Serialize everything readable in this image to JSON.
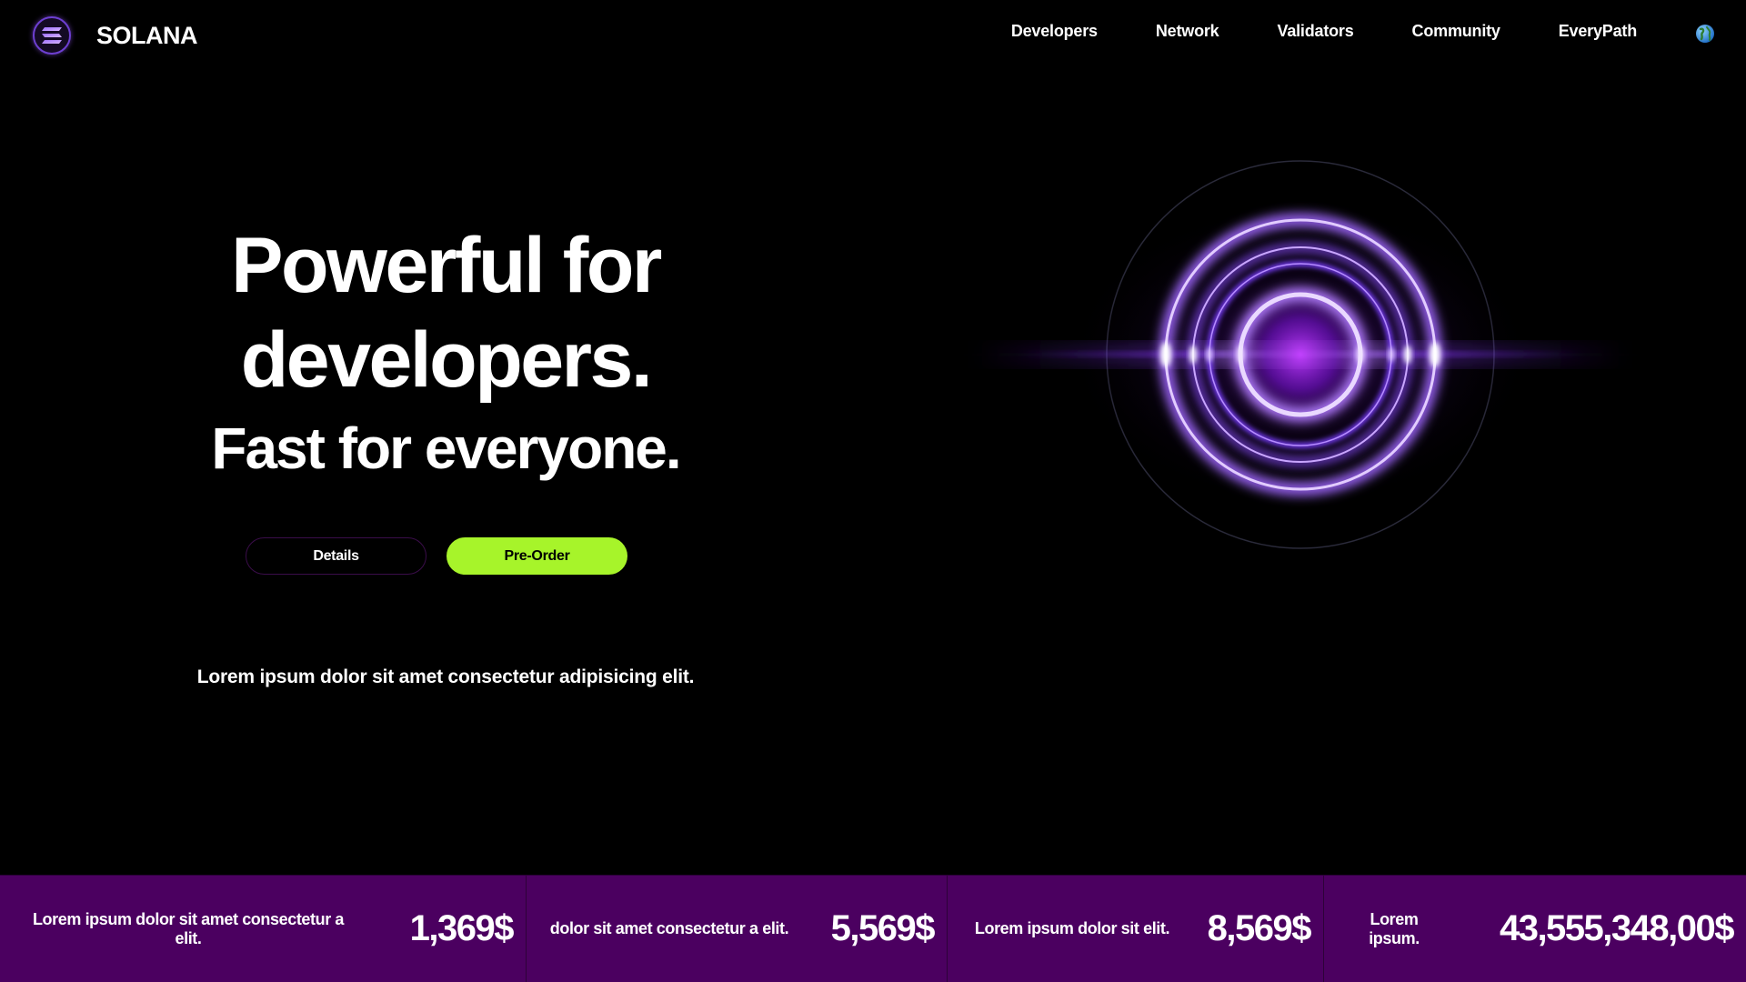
{
  "nav": {
    "brand": "SOLANA",
    "links": [
      "Developers",
      "Network",
      "Validators",
      "Community",
      "EveryPath"
    ],
    "icons": {
      "logo": "solana-logo-icon",
      "globe": "globe-icon"
    }
  },
  "hero": {
    "line1": "Powerful for",
    "line2": "developers.",
    "line3": "Fast for everyone."
  },
  "buttons": {
    "details": "Details",
    "preorder": "Pre-Order"
  },
  "description": "Lorem ipsum dolor sit amet consectetur adipisicing elit.",
  "stats": [
    {
      "label": "Lorem ipsum dolor sit amet consectetur a elit.",
      "value": "1,369$"
    },
    {
      "label": "dolor sit amet consectetur a elit.",
      "value": "5,569$"
    },
    {
      "label": "Lorem ipsum dolor sit elit.",
      "value": "8,569$"
    },
    {
      "label": "Lorem ipsum.",
      "value": "43,555,348,00$"
    }
  ],
  "colors": {
    "background": "#000000",
    "accent_green": "#a7f42a",
    "stats_bar": "#4b0060",
    "glow_purple": "#a066ff"
  }
}
